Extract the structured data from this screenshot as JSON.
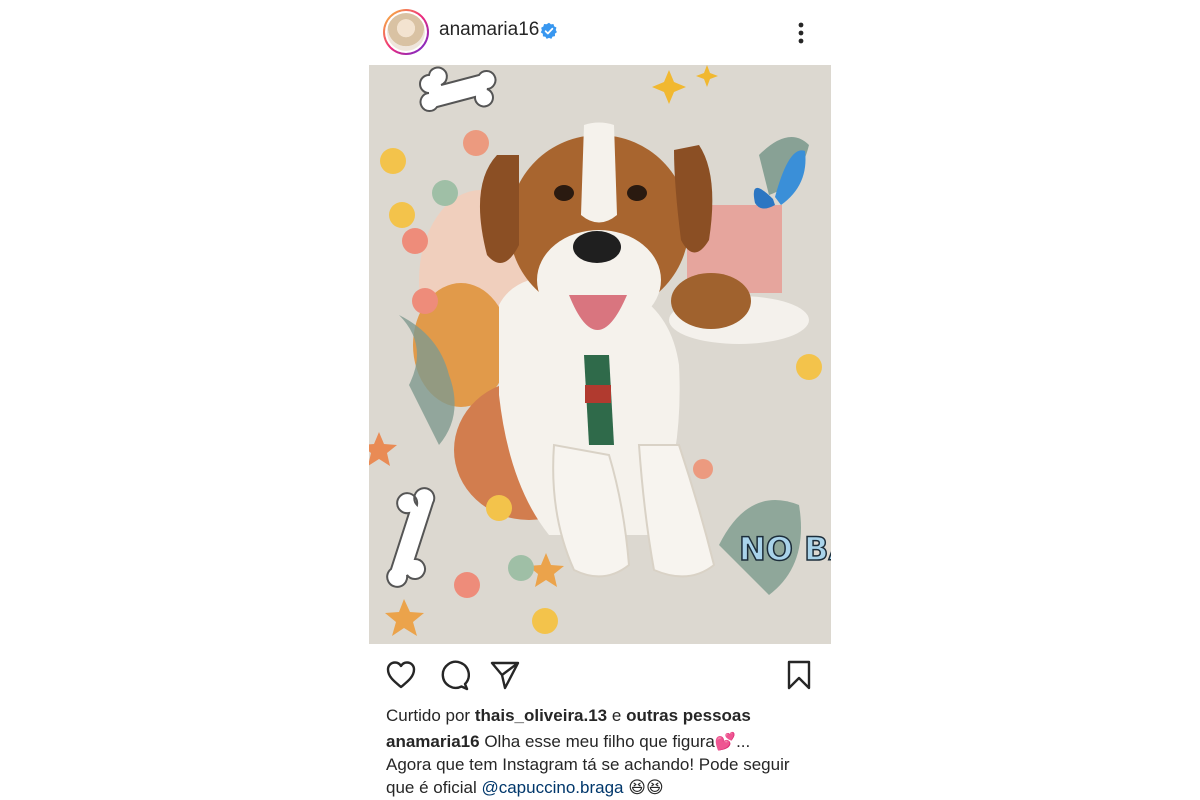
{
  "post": {
    "username": "anamaria16",
    "image_text": "NO BAD VIBES",
    "liked_prefix": "Curtido por",
    "liked_user": "thais_oliveira.13",
    "liked_and": "e",
    "liked_others": "outras pessoas",
    "caption_user": "anamaria16",
    "caption_line1": "Olha esse meu filho que figura",
    "caption_emoji1": "💕",
    "caption_ellipsis": "...",
    "caption_line2": "Agora que tem Instagram tá se achando! Pode seguir",
    "caption_line3_prefix": "que é oficial",
    "mention": "@capuccino.braga",
    "caption_emoji2": "😆😆"
  },
  "colors": {
    "verified": "#3897f0",
    "mention": "#00376b",
    "text": "#262626"
  },
  "icons": [
    "verified-icon",
    "more-options-icon",
    "like-icon",
    "comment-icon",
    "share-icon",
    "save-icon"
  ]
}
